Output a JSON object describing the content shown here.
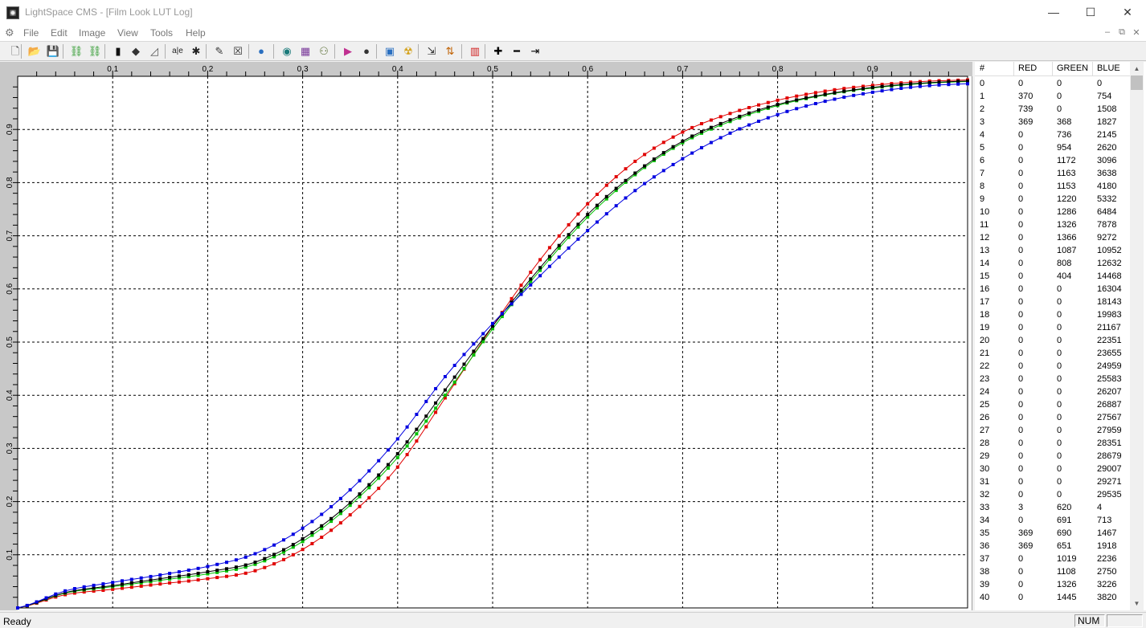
{
  "window": {
    "title": "LightSpace CMS - [Film Look LUT Log]",
    "controls": {
      "minimize": "—",
      "maximize": "☐",
      "close": "✕"
    }
  },
  "menu": {
    "items": [
      "File",
      "Edit",
      "Image",
      "View",
      "Tools",
      "Help"
    ],
    "mdi_controls": [
      "–",
      "⧉",
      "✕"
    ]
  },
  "toolbar": {
    "buttons": [
      {
        "name": "new-icon",
        "glyph": "🗋",
        "color": "#444444"
      },
      {
        "name": "open-icon",
        "glyph": "📂",
        "color": "#d4a017"
      },
      {
        "name": "save-icon",
        "glyph": "💾",
        "color": "#1f4fa0"
      },
      {
        "name": "link-icon",
        "glyph": "⛓",
        "color": "#2e9a2e"
      },
      {
        "name": "link-break-icon",
        "glyph": "⛓",
        "color": "#2e9a2e"
      },
      {
        "name": "film-icon",
        "glyph": "▮",
        "color": "#111111"
      },
      {
        "name": "cube-icon",
        "glyph": "◆",
        "color": "#333333"
      },
      {
        "name": "curve-icon",
        "glyph": "◿",
        "color": "#555555"
      },
      {
        "name": "text-tool-icon",
        "glyph": "a|e",
        "color": "#222222"
      },
      {
        "name": "star-burst-icon",
        "glyph": "✱",
        "color": "#222222"
      },
      {
        "name": "edit-pen-icon",
        "glyph": "✎",
        "color": "#333333"
      },
      {
        "name": "cross-box-icon",
        "glyph": "☒",
        "color": "#333333"
      },
      {
        "name": "globe-icon",
        "glyph": "●",
        "color": "#2a6fc0"
      },
      {
        "name": "target-icon",
        "glyph": "◉",
        "color": "#1a7a7a"
      },
      {
        "name": "image-grid-icon",
        "glyph": "▦",
        "color": "#7a3a9a"
      },
      {
        "name": "network-icon",
        "glyph": "⚇",
        "color": "#556b2f"
      },
      {
        "name": "play-color-icon",
        "glyph": "▶",
        "color": "#c03090"
      },
      {
        "name": "sphere-icon",
        "glyph": "●",
        "color": "#333333"
      },
      {
        "name": "camera-icon",
        "glyph": "▣",
        "color": "#2a6fc0"
      },
      {
        "name": "radiation-icon",
        "glyph": "☢",
        "color": "#d4a017"
      },
      {
        "name": "export-icon",
        "glyph": "⇲",
        "color": "#333333"
      },
      {
        "name": "color-sort-icon",
        "glyph": "⇅",
        "color": "#c06000"
      },
      {
        "name": "rgb-bars-icon",
        "glyph": "▥",
        "color": "#d02020"
      },
      {
        "name": "zoom-in-icon",
        "glyph": "✚",
        "color": "#000000"
      },
      {
        "name": "zoom-out-icon",
        "glyph": "━",
        "color": "#000000"
      },
      {
        "name": "fit-arrow-icon",
        "glyph": "⇥",
        "color": "#000000"
      }
    ]
  },
  "table": {
    "headers": [
      "#",
      "RED",
      "GREEN",
      "BLUE"
    ],
    "rows": [
      [
        "0",
        "0",
        "0",
        "0"
      ],
      [
        "1",
        "370",
        "0",
        "754"
      ],
      [
        "2",
        "739",
        "0",
        "1508"
      ],
      [
        "3",
        "369",
        "368",
        "1827"
      ],
      [
        "4",
        "0",
        "736",
        "2145"
      ],
      [
        "5",
        "0",
        "954",
        "2620"
      ],
      [
        "6",
        "0",
        "1172",
        "3096"
      ],
      [
        "7",
        "0",
        "1163",
        "3638"
      ],
      [
        "8",
        "0",
        "1153",
        "4180"
      ],
      [
        "9",
        "0",
        "1220",
        "5332"
      ],
      [
        "10",
        "0",
        "1286",
        "6484"
      ],
      [
        "11",
        "0",
        "1326",
        "7878"
      ],
      [
        "12",
        "0",
        "1366",
        "9272"
      ],
      [
        "13",
        "0",
        "1087",
        "10952"
      ],
      [
        "14",
        "0",
        "808",
        "12632"
      ],
      [
        "15",
        "0",
        "404",
        "14468"
      ],
      [
        "16",
        "0",
        "0",
        "16304"
      ],
      [
        "17",
        "0",
        "0",
        "18143"
      ],
      [
        "18",
        "0",
        "0",
        "19983"
      ],
      [
        "19",
        "0",
        "0",
        "21167"
      ],
      [
        "20",
        "0",
        "0",
        "22351"
      ],
      [
        "21",
        "0",
        "0",
        "23655"
      ],
      [
        "22",
        "0",
        "0",
        "24959"
      ],
      [
        "23",
        "0",
        "0",
        "25583"
      ],
      [
        "24",
        "0",
        "0",
        "26207"
      ],
      [
        "25",
        "0",
        "0",
        "26887"
      ],
      [
        "26",
        "0",
        "0",
        "27567"
      ],
      [
        "27",
        "0",
        "0",
        "27959"
      ],
      [
        "28",
        "0",
        "0",
        "28351"
      ],
      [
        "29",
        "0",
        "0",
        "28679"
      ],
      [
        "30",
        "0",
        "0",
        "29007"
      ],
      [
        "31",
        "0",
        "0",
        "29271"
      ],
      [
        "32",
        "0",
        "0",
        "29535"
      ],
      [
        "33",
        "3",
        "620",
        "4"
      ],
      [
        "34",
        "0",
        "691",
        "713"
      ],
      [
        "35",
        "369",
        "690",
        "1467"
      ],
      [
        "36",
        "369",
        "651",
        "1918"
      ],
      [
        "37",
        "0",
        "1019",
        "2236"
      ],
      [
        "38",
        "0",
        "1108",
        "2750"
      ],
      [
        "39",
        "0",
        "1326",
        "3226"
      ],
      [
        "40",
        "0",
        "1445",
        "3820"
      ]
    ]
  },
  "graph": {
    "x_ticks": [
      "0.1",
      "0.2",
      "0.3",
      "0.4",
      "0.5",
      "0.6",
      "0.7",
      "0.8",
      "0.9"
    ],
    "y_ticks": [
      "0.1",
      "0.2",
      "0.3",
      "0.4",
      "0.5",
      "0.6",
      "0.7",
      "0.8",
      "0.9"
    ],
    "colors": {
      "red": "#e00000",
      "green": "#00c000",
      "blue": "#0000e0",
      "black": "#000000"
    }
  },
  "chart_data": {
    "type": "line",
    "xlim": [
      0,
      1
    ],
    "ylim": [
      0,
      1
    ],
    "grid": true,
    "x": [
      0.0,
      0.05,
      0.1,
      0.15,
      0.2,
      0.25,
      0.3,
      0.35,
      0.4,
      0.45,
      0.5,
      0.55,
      0.6,
      0.65,
      0.7,
      0.75,
      0.8,
      0.85,
      0.9,
      0.95,
      1.0
    ],
    "series": [
      {
        "color": "#e00000",
        "values": [
          0.0,
          0.025,
          0.035,
          0.045,
          0.055,
          0.07,
          0.11,
          0.175,
          0.265,
          0.395,
          0.53,
          0.655,
          0.76,
          0.84,
          0.895,
          0.93,
          0.955,
          0.972,
          0.983,
          0.99,
          0.993
        ]
      },
      {
        "color": "#00c000",
        "values": [
          0.0,
          0.028,
          0.04,
          0.052,
          0.064,
          0.082,
          0.125,
          0.193,
          0.283,
          0.4,
          0.525,
          0.635,
          0.735,
          0.815,
          0.875,
          0.915,
          0.945,
          0.965,
          0.978,
          0.986,
          0.99
        ]
      },
      {
        "color": "#000000",
        "values": [
          0.0,
          0.029,
          0.042,
          0.055,
          0.068,
          0.086,
          0.13,
          0.198,
          0.29,
          0.41,
          0.53,
          0.64,
          0.74,
          0.818,
          0.878,
          0.918,
          0.947,
          0.966,
          0.979,
          0.987,
          0.991
        ]
      },
      {
        "color": "#0000e0",
        "values": [
          0.0,
          0.032,
          0.048,
          0.062,
          0.078,
          0.102,
          0.15,
          0.222,
          0.318,
          0.435,
          0.535,
          0.625,
          0.71,
          0.785,
          0.845,
          0.893,
          0.928,
          0.953,
          0.97,
          0.981,
          0.986
        ]
      }
    ]
  },
  "status": {
    "text": "Ready",
    "num": "NUM"
  }
}
